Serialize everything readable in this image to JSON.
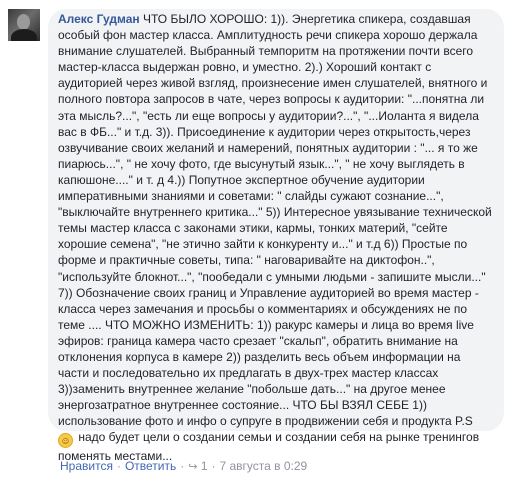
{
  "comment": {
    "author": "Алекс Гудман",
    "text": "ЧТО БЫЛО ХОРОШО: 1)). Энергетика спикера, создавшая\nособый фон мастер класса. Амплитудность речи спикера хорошо держала\nвнимание слушателей. Выбранный темпоритм на протяжении почти всего\nмастер-класса выдержан ровно, и уместно. 2).) Хороший контакт с\nаудиторией через живой взгляд, произнесение имен слушателей, внятного и\nполного повтора запросов в чате, через вопросы к аудитории: \"...понятна ли\nэта мысль?...\", \"есть ли еще вопросы у аудитории?...\", \"...Иоланта я видела\nвас в ФБ...\" и т.д. 3)). Присоединение к аудитории через открытость,через\nозвучивание своих желаний и намерений, понятных аудитории : \"... я то же\nпиарюсь...\", \" не хочу фото, где высунутый язык...\", \" не хочу выглядеть в\nкапюшоне....\" и т. д 4.)) Попутное экспертное обучение аудитории\nимперативными знаниями и советами: \" слайды сужают сознание...\",\n\"выключайте внутреннего критика...\" 5)) Интересное увязывание технической\nтемы мастер класса с законами этики, кармы, тонких материй, \"сейте\nхорошие семена\", \"не этично зайти к конкуренту и...\" и т.д 6)) Простые по\nформе и практичные советы, типа: \" наговаривайте на диктофон..\",\n\"используйте блокнот...\", \"пообедали с умными людьми - запишите мысли...\"\n7)) Обозначение своих границ и Управление аудиторией во время мастер -\nкласса через замечания и просьбы о комментариях и обсуждениях не по\nтеме .... ЧТО МОЖНО ИЗМЕНИТЬ: 1)) ракурс камеры и лица во время live\nэфиров: граница камера часто срезает \"скальп\", обратить внимание на\nотклонения корпуса в камере 2)) разделить весь объем информации на\nчасти и последовательно их предлагать в двух-трех мастер классах\n3))заменить внутреннее желание \"побольше дать...\" на другое менее\nэнергозатратное внутреннее состояние... ЧТО БЫ ВЗЯЛ СЕБЕ 1))\nиспользование фото и инфо о супруге в продвижении себя и продукта P.S\n",
    "text_after_emoji": "надо будет цели о создании семьи и создании себя на рынке тренингов\nпоменять местами...",
    "emoji_icon": "smiley-emoji"
  },
  "actions": {
    "like_label": "Нравится",
    "reply_label": "Ответить",
    "reaction_count": "1",
    "timestamp": "7 августа в 0:29"
  }
}
